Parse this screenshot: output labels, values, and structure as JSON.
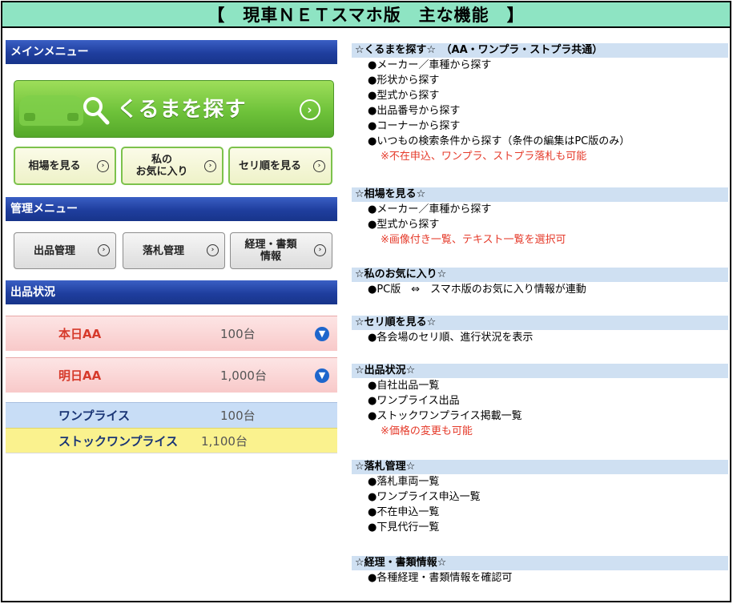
{
  "title": "【　現車ＮＥＴスマホ版　主な機能　】",
  "phone": {
    "main_menu_label": "メインメニュー",
    "search_label": "くるまを探す",
    "search_arrow": "⊛",
    "sub_buttons": [
      {
        "label": "相場を見る"
      },
      {
        "label": "私の\nお気に入り"
      },
      {
        "label": "セリ順を見る"
      }
    ],
    "mgmt_menu_label": "管理メニュー",
    "mgmt_buttons": [
      {
        "label": "出品管理"
      },
      {
        "label": "落札管理"
      },
      {
        "label": "経理・書類\n情報"
      }
    ],
    "status_label": "出品状況",
    "status_rows": [
      {
        "name": "本日AA",
        "count": "100台"
      },
      {
        "name": "明日AA",
        "count": "1,000台"
      },
      {
        "name": "ワンプライス",
        "count": "100台"
      },
      {
        "name": "ストックワンプライス",
        "count": "1,100台"
      }
    ]
  },
  "features": [
    {
      "heading": "☆くるまを探す☆　（AA・ワンプラ・ストプラ共通）",
      "items": [
        "●メーカー／車種から探す",
        "●形状から探す",
        "●型式から探す",
        "●出品番号から探す",
        "●コーナーから探す",
        "●いつもの検索条件から探す（条件の編集はPC版のみ）"
      ],
      "note": "※不在申込、ワンプラ、ストプラ落札も可能"
    },
    {
      "heading": "☆相場を見る☆",
      "items": [
        "●メーカー／車種から探す",
        "●型式から探す"
      ],
      "note": "※画像付き一覧、テキスト一覧を選択可"
    },
    {
      "heading": "☆私のお気に入り☆",
      "items": [
        "●PC版　⇔　スマホ版のお気に入り情報が連動"
      ],
      "note": ""
    },
    {
      "heading": "☆セリ順を見る☆",
      "items": [
        "●各会場のセリ順、進行状況を表示"
      ],
      "note": ""
    },
    {
      "heading": "☆出品状況☆",
      "items": [
        "●自社出品一覧",
        "●ワンプライス出品",
        "●ストックワンプライス掲載一覧"
      ],
      "note": "※価格の変更も可能"
    },
    {
      "heading": "☆落札管理☆",
      "items": [
        "●落札車両一覧",
        "●ワンプライス申込一覧",
        "●不在申込一覧",
        "●下見代行一覧"
      ],
      "note": ""
    },
    {
      "heading": "☆経理・書類情報☆",
      "items": [
        "●各種経理・書類情報を確認可"
      ],
      "note": ""
    }
  ],
  "colors": {
    "title_bg": "#8ee4c3",
    "section_bar": "#1f3e9e",
    "search_green": "#6ec23a",
    "feature_head_bg": "#cfe0f2",
    "note_red": "#e53a2a"
  }
}
